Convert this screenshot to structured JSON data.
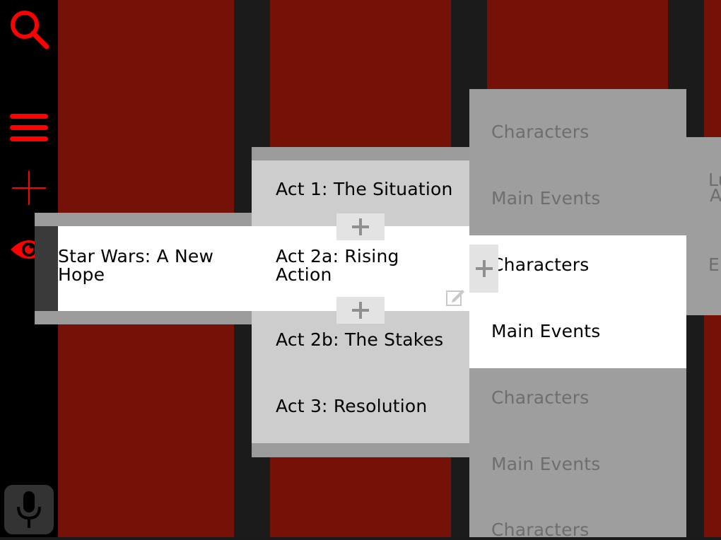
{
  "toolbar": {
    "icons": [
      "search-icon",
      "menu-icon",
      "add-icon",
      "eye-icon",
      "microphone-icon"
    ],
    "accent_color": "#ff0000"
  },
  "story": {
    "title": "Star Wars: A New Hope"
  },
  "acts": [
    {
      "label": "Act 1: The Situation"
    },
    {
      "label": "Act 2a: Rising Action"
    },
    {
      "label": "Act 2b: The Stakes"
    },
    {
      "label": "Act 3: Resolution"
    }
  ],
  "sections": {
    "top": [
      "Characters",
      "Main Events"
    ],
    "active": [
      "Characters",
      "Main Events"
    ],
    "lower": [
      "Characters",
      "Main Events",
      "Characters"
    ]
  },
  "edge_column": {
    "partial_lines": [
      "Lu",
      "A",
      "Er"
    ]
  },
  "colors": {
    "column_red": "#761107",
    "column_dark": "#1b1b1b",
    "active_card": "#ffffff",
    "act_card": "#cdcdcd",
    "section_card": "#9e9e9e"
  }
}
